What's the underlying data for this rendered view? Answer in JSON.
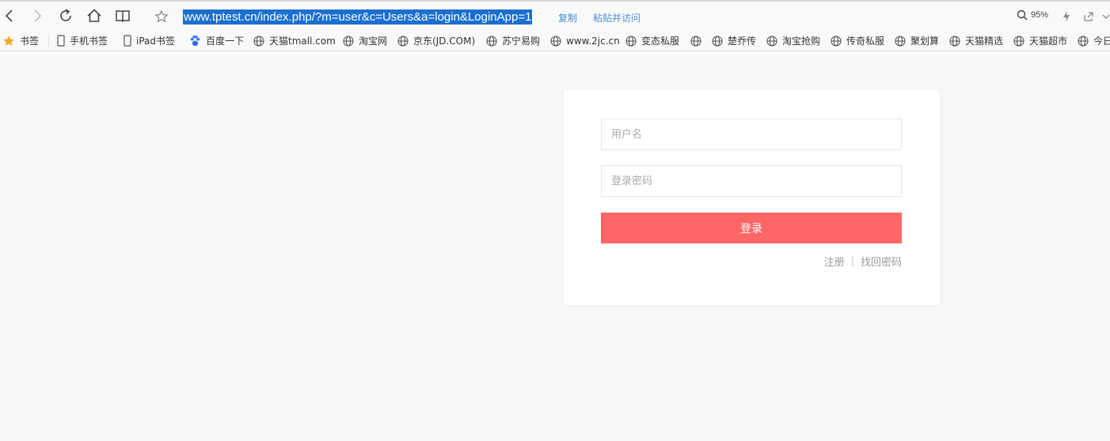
{
  "browser": {
    "address_url": "www.tptest.cn/index.php/?m=user&c=Users&a=login&LoginApp=1",
    "copy_label": "复制",
    "paste_go_label": "粘贴并访问",
    "zoom_level": "95%"
  },
  "bookmarks": {
    "items": [
      {
        "label": "书签",
        "icon": "star-icon"
      },
      {
        "label": "手机书签",
        "icon": "phone-icon"
      },
      {
        "label": "iPad书签",
        "icon": "tablet-icon"
      },
      {
        "label": "百度一下",
        "icon": "baidu-paw-icon"
      },
      {
        "label": "天猫tmall.com",
        "icon": "globe-icon"
      },
      {
        "label": "淘宝网",
        "icon": "globe-icon"
      },
      {
        "label": "京东(JD.COM)",
        "icon": "globe-icon"
      },
      {
        "label": "苏宁易购",
        "icon": "globe-icon"
      },
      {
        "label": "www.2jc.cn",
        "icon": "globe-icon"
      },
      {
        "label": "变态私服",
        "icon": "globe-icon"
      },
      {
        "label": "",
        "icon": "globe-icon"
      },
      {
        "label": "楚乔传",
        "icon": "globe-icon"
      },
      {
        "label": "淘宝抢购",
        "icon": "globe-icon"
      },
      {
        "label": "传奇私服",
        "icon": "globe-icon"
      },
      {
        "label": "聚划算",
        "icon": "globe-icon"
      },
      {
        "label": "天猫精选",
        "icon": "globe-icon"
      },
      {
        "label": "天猫超市",
        "icon": "globe-icon"
      },
      {
        "label": "今日",
        "icon": "globe-icon"
      }
    ]
  },
  "login": {
    "username_placeholder": "用户名",
    "password_placeholder": "登录密码",
    "submit_label": "登录",
    "register_label": "注册",
    "divider": "|",
    "forgot_label": "找回密码"
  },
  "colors": {
    "accent": "#ff6666",
    "url_highlight": "#1a6fd0",
    "link_blue": "#4a8fd8",
    "page_bg": "#f8f8f8"
  }
}
